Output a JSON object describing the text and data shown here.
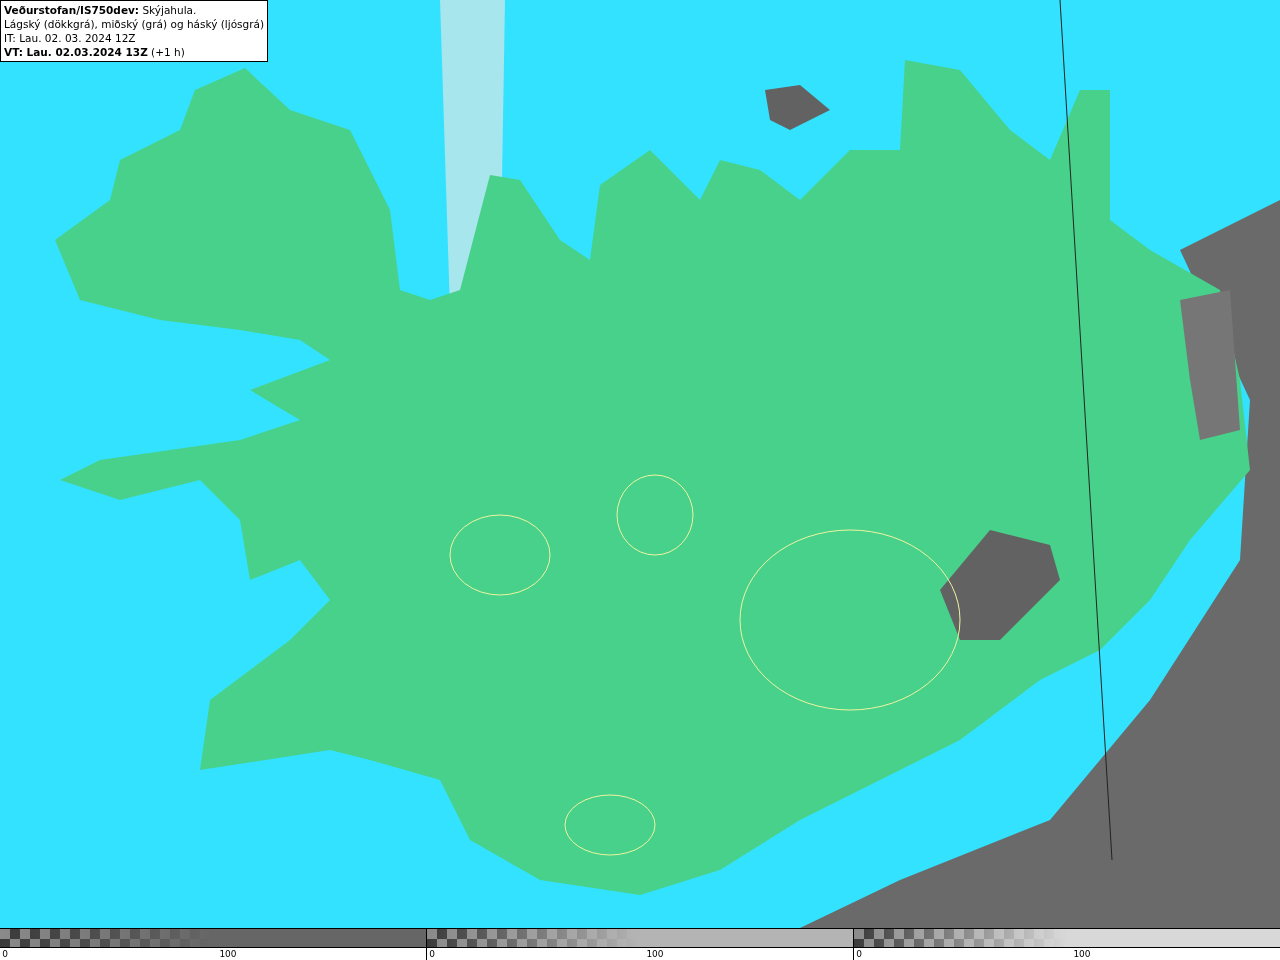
{
  "info_box": {
    "lines": [
      "**Veðurstofan/IS750dev:** Skýjahula.",
      "Lágský (dökkgrá), miðský (grá) og háský (ljósgrá)",
      "IT: Lau. 02. 03. 2024 12Z",
      "**VT: Lau. 02.03.2024 13Z** (+1 h)"
    ]
  },
  "colorbars": [
    {
      "color": "#666666",
      "ticks": [
        "0",
        "100"
      ]
    },
    {
      "color": "#b4b4b4",
      "ticks": [
        "0",
        "100"
      ]
    },
    {
      "color": "#d8d8d8",
      "ticks": [
        "0",
        "100"
      ]
    }
  ]
}
